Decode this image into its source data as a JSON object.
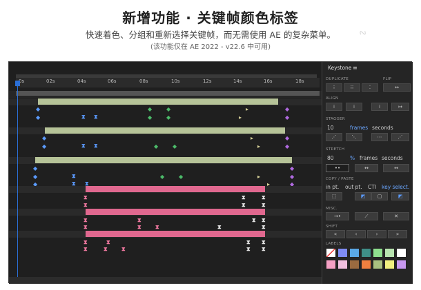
{
  "header": {
    "title": "新增功能 · 关键帧颜色标签",
    "subtitle": "快速着色、分组和重新选择关键帧，而无需使用 AE 的复杂菜单。",
    "note": "(该功能仅在 AE 2022 - v22.6 中可用)"
  },
  "timeline": {
    "ruler_labels": [
      "0s",
      "02s",
      "04s",
      "06s",
      "08s",
      "10s",
      "12s",
      "14s",
      "16s",
      "18s"
    ],
    "colors": {
      "playhead": "#2b6fd6",
      "green_bar": "#b6c398",
      "pink_bar": "#e0688f"
    }
  },
  "panel": {
    "title": "Keystone",
    "menu_icon": "≡",
    "sections": {
      "duplicate": "DUPLICATE",
      "flip": "FLIP",
      "align": "ALIGN",
      "stagger": "STAGGER",
      "stretch": "STRETCH",
      "copy_paste": "COPY / PASTE",
      "misc": "MISC.",
      "shift": "SHIFT",
      "labels": "LABELS"
    },
    "stagger_value": "10",
    "stagger_unit_frames": "frames",
    "stagger_unit_seconds": "seconds",
    "stretch_value": "80",
    "stretch_unit_percent": "%",
    "stretch_unit_frames": "frames",
    "stretch_unit_seconds": "seconds",
    "copy_in_pt": "in pt.",
    "copy_out_pt": "out pt.",
    "copy_cti": "CTI",
    "copy_key_select": "key select.",
    "shift_buttons": [
      "«",
      "‹",
      "›",
      "»"
    ],
    "label_colors": [
      "#ffffff",
      "#7f8cf5",
      "#5aa8e6",
      "#3f8f88",
      "#8fe08f",
      "#b8e4b0",
      "#ffffff",
      "#f4a0c4",
      "#f0c0e0",
      "#9a6b40",
      "#f08040",
      "#a8c080",
      "#f0f080",
      "#c898f0"
    ]
  }
}
